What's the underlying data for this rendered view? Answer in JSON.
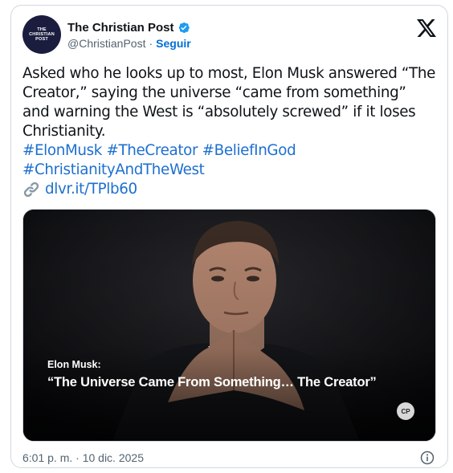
{
  "post": {
    "author": {
      "name": "The Christian Post",
      "handle": "@ChristianPost",
      "separator": "·",
      "follow_label": "Seguir",
      "avatar_text": "THE CHRISTIAN POST",
      "verified": true
    },
    "text": "Asked who he looks up to most, Elon Musk answered “The Creator,” saying the universe “came from something” and warning the West is “absolutely screwed” if it loses Christianity.",
    "hashtags": [
      "#ElonMusk",
      "#TheCreator",
      "#BeliefInGod",
      "#ChristianityAndTheWest"
    ],
    "link": "dlvr.it/TPlb60",
    "media": {
      "caption_name": "Elon Musk:",
      "caption_quote": "“The Universe Came From Something… The Creator”",
      "badge": "CP"
    },
    "timestamp": "6:01 p. m. · 10 dic. 2025"
  },
  "icons": {
    "verified": "verified-badge-icon",
    "platform": "x-logo-icon",
    "link": "link-icon",
    "info": "info-icon"
  },
  "colors": {
    "link": "#1d6fd0",
    "follow": "#006fd6",
    "verified": "#1d9bf0",
    "secondary_text": "#536471"
  }
}
